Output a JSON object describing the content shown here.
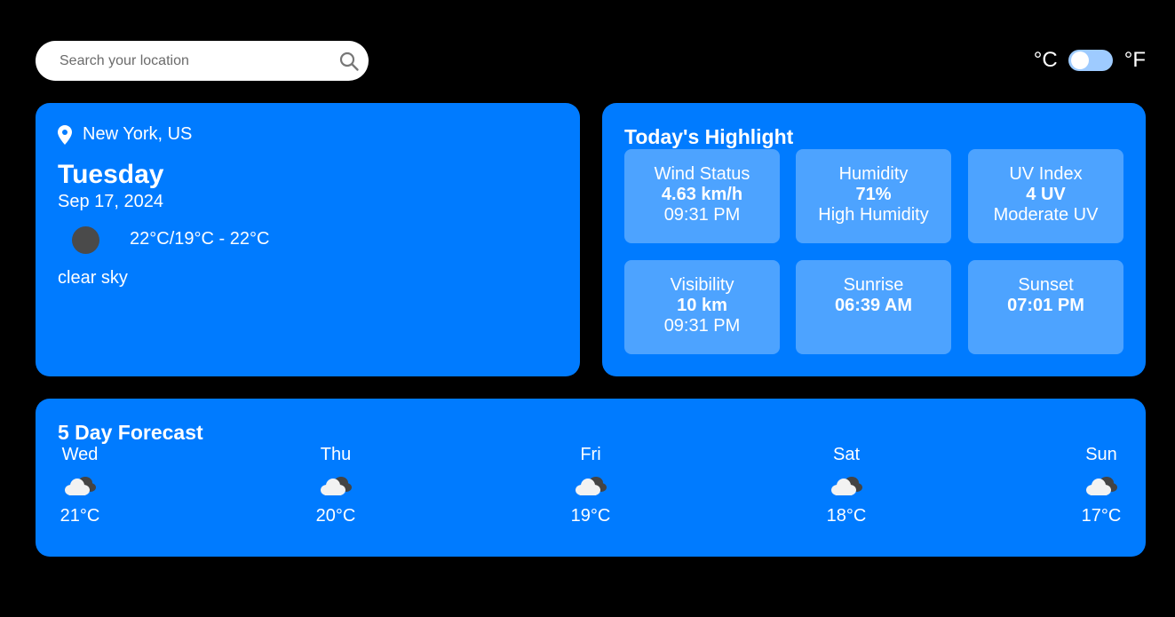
{
  "search": {
    "placeholder": "Search your location"
  },
  "units": {
    "celsius": "°C",
    "fahrenheit": "°F",
    "selected": "celsius"
  },
  "current": {
    "location": "New York, US",
    "day": "Tuesday",
    "date": "Sep 17, 2024",
    "temps": "22°C/19°C - 22°C",
    "condition": "clear sky"
  },
  "highlight": {
    "title": "Today's Highlight",
    "tiles": [
      {
        "label": "Wind Status",
        "value": "4.63 km/h",
        "sub": "09:31 PM"
      },
      {
        "label": "Humidity",
        "value": "71%",
        "sub": "High Humidity"
      },
      {
        "label": "UV Index",
        "value": "4 UV",
        "sub": "Moderate UV"
      },
      {
        "label": "Visibility",
        "value": "10 km",
        "sub": "09:31 PM"
      },
      {
        "label": "Sunrise",
        "value": "06:39 AM",
        "sub": ""
      },
      {
        "label": "Sunset",
        "value": "07:01 PM",
        "sub": ""
      }
    ]
  },
  "forecast": {
    "title": "5 Day Forecast",
    "days": [
      {
        "day": "Wed",
        "temp": "21°C",
        "icon": "cloud-icon"
      },
      {
        "day": "Thu",
        "temp": "20°C",
        "icon": "cloud-icon"
      },
      {
        "day": "Fri",
        "temp": "19°C",
        "icon": "cloud-icon"
      },
      {
        "day": "Sat",
        "temp": "18°C",
        "icon": "cloud-icon"
      },
      {
        "day": "Sun",
        "temp": "17°C",
        "icon": "cloud-icon"
      }
    ]
  },
  "colors": {
    "background": "#000000",
    "card": "#007bff",
    "tile": "#4da3ff",
    "toggle": "#9ecbff"
  }
}
